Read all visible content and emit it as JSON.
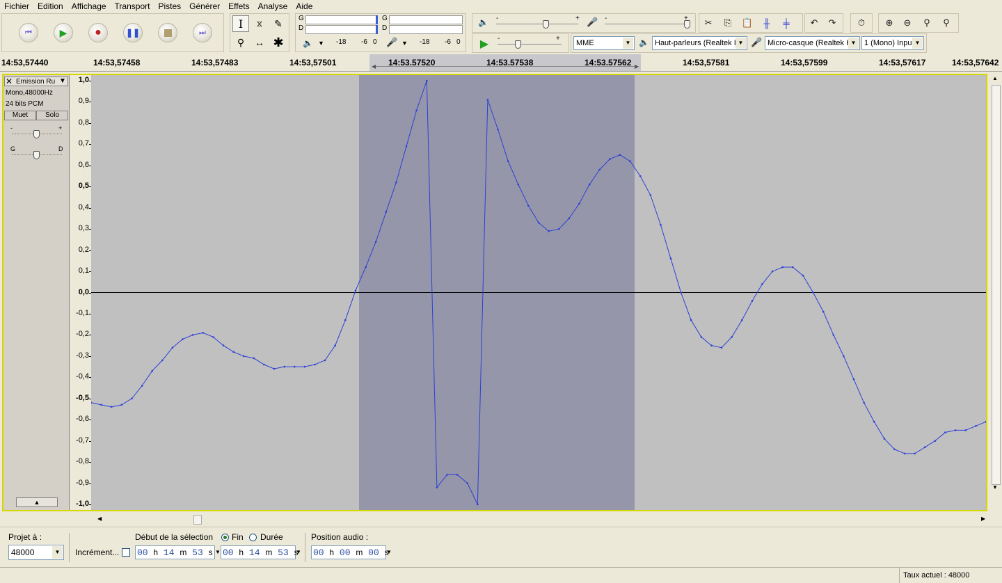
{
  "menu": [
    "Fichier",
    "Edition",
    "Affichage",
    "Transport",
    "Pistes",
    "Générer",
    "Effets",
    "Analyse",
    "Aide"
  ],
  "meters": {
    "play_channel_left": "G",
    "play_channel_right": "D",
    "rec_channel_left": "G",
    "rec_channel_right": "D",
    "play_scale": [
      "-18",
      "-6",
      "0"
    ],
    "rec_scale": [
      "-18",
      "-6",
      "0"
    ]
  },
  "mixer": {
    "minus": "-",
    "plus": "+"
  },
  "devices": {
    "host": "MME",
    "output": "Haut-parleurs (Realtek I",
    "input": "Micro-casque (Realtek H",
    "channels": "1 (Mono) Inpu"
  },
  "ruler": {
    "labels": [
      "14:53,57440",
      "14:53,57458",
      "14:53,57483",
      "14:53,57501",
      "14:53.57520",
      "14:53.57538",
      "14:53.57562",
      "14:53,57581",
      "14:53,57599",
      "14:53,57617",
      "14:53,57642"
    ]
  },
  "track": {
    "name": "Emission Ru",
    "format": "Mono,48000Hz",
    "bits": "24 bits PCM",
    "mute": "Muet",
    "solo": "Solo",
    "gain_minus": "-",
    "gain_plus": "+",
    "pan_left": "G",
    "pan_right": "D",
    "yaxis": [
      "1,0",
      "0,9",
      "0,8",
      "0,7",
      "0,6",
      "0,5",
      "0,4",
      "0,3",
      "0,2",
      "0,1",
      "0,0",
      "-0,1",
      "-0,2",
      "-0,3",
      "-0,4",
      "-0,5",
      "-0,6",
      "-0,7",
      "-0,8",
      "-0,9",
      "-1,0"
    ],
    "samples": [
      -0.52,
      -0.53,
      -0.54,
      -0.53,
      -0.5,
      -0.44,
      -0.37,
      -0.32,
      -0.26,
      -0.22,
      -0.2,
      -0.19,
      -0.21,
      -0.25,
      -0.28,
      -0.3,
      -0.31,
      -0.34,
      -0.36,
      -0.35,
      -0.35,
      -0.35,
      -0.34,
      -0.32,
      -0.25,
      -0.13,
      0.01,
      0.12,
      0.24,
      0.38,
      0.52,
      0.69,
      0.86,
      1.0,
      -0.92,
      -0.86,
      -0.86,
      -0.9,
      -1.0,
      0.91,
      0.77,
      0.62,
      0.51,
      0.41,
      0.33,
      0.29,
      0.3,
      0.35,
      0.42,
      0.51,
      0.58,
      0.63,
      0.65,
      0.62,
      0.55,
      0.46,
      0.32,
      0.16,
      0.0,
      -0.13,
      -0.21,
      -0.25,
      -0.26,
      -0.21,
      -0.13,
      -0.04,
      0.04,
      0.1,
      0.12,
      0.12,
      0.08,
      0.0,
      -0.09,
      -0.2,
      -0.3,
      -0.41,
      -0.52,
      -0.61,
      -0.69,
      -0.74,
      -0.76,
      -0.76,
      -0.73,
      -0.7,
      -0.66,
      -0.65,
      -0.65,
      -0.63,
      -0.61
    ]
  },
  "bottom": {
    "project_rate_label": "Projet à :",
    "project_rate": "48000",
    "snap_label": "Incrément...",
    "selection_start_label": "Début de la sélection",
    "end_label": "Fin",
    "length_label": "Durée",
    "audio_position_label": "Position audio :",
    "start_time": [
      "00",
      "h",
      "14",
      "m",
      "53",
      "s"
    ],
    "end_time": [
      "00",
      "h",
      "14",
      "m",
      "53",
      "s"
    ],
    "audio_position": [
      "00",
      "h",
      "00",
      "m",
      "00",
      "s"
    ]
  },
  "status": {
    "actual_rate": "Taux actuel : 48000"
  },
  "colors": {
    "wave": "#2b3fd6",
    "selection": "#9696aa",
    "background": "#c0c0c0",
    "focus_border": "#d6d600"
  }
}
